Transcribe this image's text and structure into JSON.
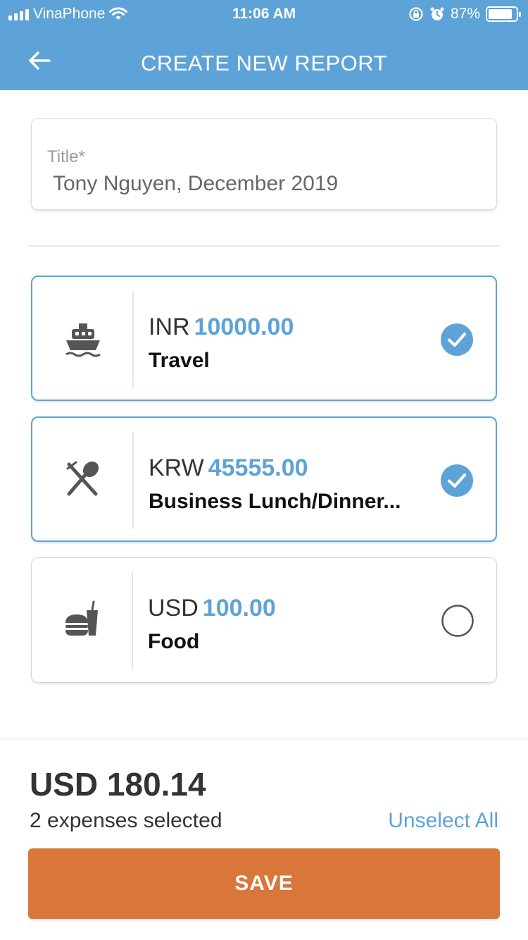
{
  "status_bar": {
    "carrier": "VinaPhone",
    "time": "11:06 AM",
    "battery_percent": "87%",
    "battery_level": 0.87,
    "icons": [
      "signal-icon",
      "wifi-icon",
      "rotation-lock-icon",
      "alarm-icon",
      "battery-icon"
    ]
  },
  "header": {
    "title": "CREATE NEW REPORT",
    "back_icon": "back-arrow-icon"
  },
  "title_field": {
    "label": "Title*",
    "value": "Tony Nguyen, December 2019"
  },
  "expenses": [
    {
      "currency": "INR",
      "amount": "10000.00",
      "category": "Travel",
      "icon": "ship-icon",
      "selected": true
    },
    {
      "currency": "KRW",
      "amount": "45555.00",
      "category": "Business Lunch/Dinner...",
      "icon": "fork-spoon-icon",
      "selected": true
    },
    {
      "currency": "USD",
      "amount": "100.00",
      "category": "Food",
      "icon": "burger-drink-icon",
      "selected": false
    }
  ],
  "footer": {
    "total": "USD 180.14",
    "selected_count": "2 expenses selected",
    "unselect_label": "Unselect All",
    "save_label": "SAVE"
  },
  "colors": {
    "accent": "#5ea3d8",
    "save_button": "#d9763a",
    "icon_gray": "#555555"
  }
}
